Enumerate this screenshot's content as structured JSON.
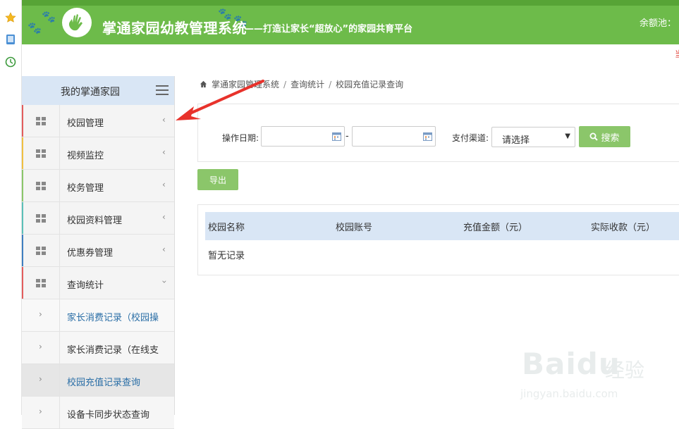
{
  "browser_rail": {
    "icons": [
      "star-icon",
      "tablet-icon",
      "clock-icon"
    ]
  },
  "header": {
    "title": "掌通家园幼教管理系统",
    "slogan": "——打造让家长“超放心”的家园共育平台",
    "balance_label": "余额池：",
    "right_mark": "当"
  },
  "sidebar": {
    "title": "我的掌通家园",
    "menu": [
      {
        "label": "校园管理",
        "accent": "#e25d5d"
      },
      {
        "label": "视频监控",
        "accent": "#f0c040"
      },
      {
        "label": "校务管理",
        "accent": "#8bc66a"
      },
      {
        "label": "校园资料管理",
        "accent": "#5bc0b8"
      },
      {
        "label": "优惠券管理",
        "accent": "#3f7fc0"
      },
      {
        "label": "查询统计",
        "accent": "#e25d5d"
      }
    ],
    "submenu": [
      {
        "label": "家长消费记录（校园操"
      },
      {
        "label": "家长消费记录（在线支"
      },
      {
        "label": "校园充值记录查询"
      },
      {
        "label": "设备卡同步状态查询"
      }
    ]
  },
  "breadcrumb": [
    "掌通家园管理系统",
    "查询统计",
    "校园充值记录查询"
  ],
  "filters": {
    "date_label": "操作日期:",
    "date_sep": "-",
    "channel_label": "支付渠道:",
    "channel_value": "请选择",
    "search_label": "搜索"
  },
  "export_label": "导出",
  "table": {
    "columns": [
      "校园名称",
      "校园账号",
      "充值金额（元）",
      "实际收款（元）"
    ],
    "empty_text": "暂无记录"
  },
  "watermark": {
    "logo": "Baidu",
    "cn": "经验",
    "url": "jingyan.baidu.com"
  },
  "colors": {
    "header_green": "#6dbb4a",
    "button_green": "#8bc66a",
    "table_head": "#d9e6f5",
    "arrow_red": "#e8322b"
  }
}
